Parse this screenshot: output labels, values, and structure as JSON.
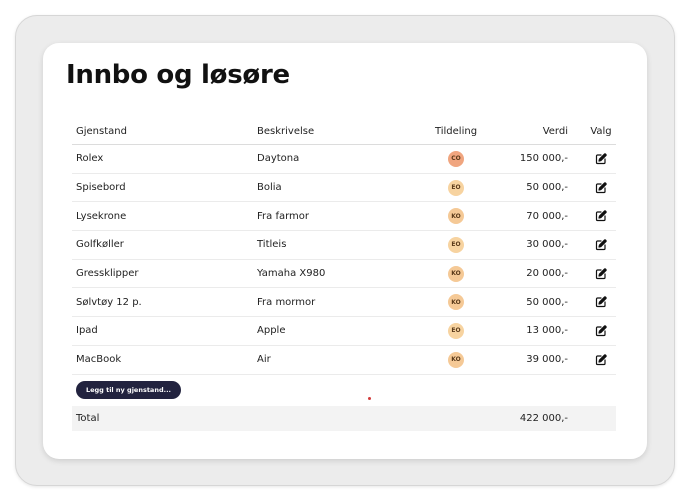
{
  "page": {
    "title": "Innbo og løsøre"
  },
  "table": {
    "headers": {
      "item": "Gjenstand",
      "description": "Beskrivelse",
      "assignment": "Tildeling",
      "value": "Verdi",
      "action": "Valg"
    },
    "rows": [
      {
        "item": "Rolex",
        "description": "Daytona",
        "badge": "CO",
        "badge_color": "#f0a57f",
        "value": "150 000,-"
      },
      {
        "item": "Spisebord",
        "description": "Bolia",
        "badge": "EO",
        "badge_color": "#f7d3a0",
        "value": "50 000,-"
      },
      {
        "item": "Lysekrone",
        "description": "Fra farmor",
        "badge": "KO",
        "badge_color": "#f5c996",
        "value": "70 000,-"
      },
      {
        "item": "Golfkøller",
        "description": "Titleis",
        "badge": "EO",
        "badge_color": "#f7d3a0",
        "value": "30 000,-"
      },
      {
        "item": "Gressklipper",
        "description": "Yamaha X980",
        "badge": "KO",
        "badge_color": "#f5c996",
        "value": "20 000,-"
      },
      {
        "item": "Sølvtøy 12 p.",
        "description": "Fra mormor",
        "badge": "KO",
        "badge_color": "#f5c996",
        "value": "50 000,-"
      },
      {
        "item": "Ipad",
        "description": "Apple",
        "badge": "EO",
        "badge_color": "#f7d3a0",
        "value": "13 000,-"
      },
      {
        "item": "MacBook",
        "description": "Air",
        "badge": "KO",
        "badge_color": "#f5c996",
        "value": "39 000,-"
      }
    ],
    "edit_icon": "edit-icon"
  },
  "add_button": {
    "label": "Legg til ny gjenstand..."
  },
  "total": {
    "label": "Total",
    "value": "422 000,-"
  },
  "colors": {
    "button_bg": "#22233f",
    "total_bg": "#f3f3f3",
    "frame_bg": "#ececec"
  }
}
